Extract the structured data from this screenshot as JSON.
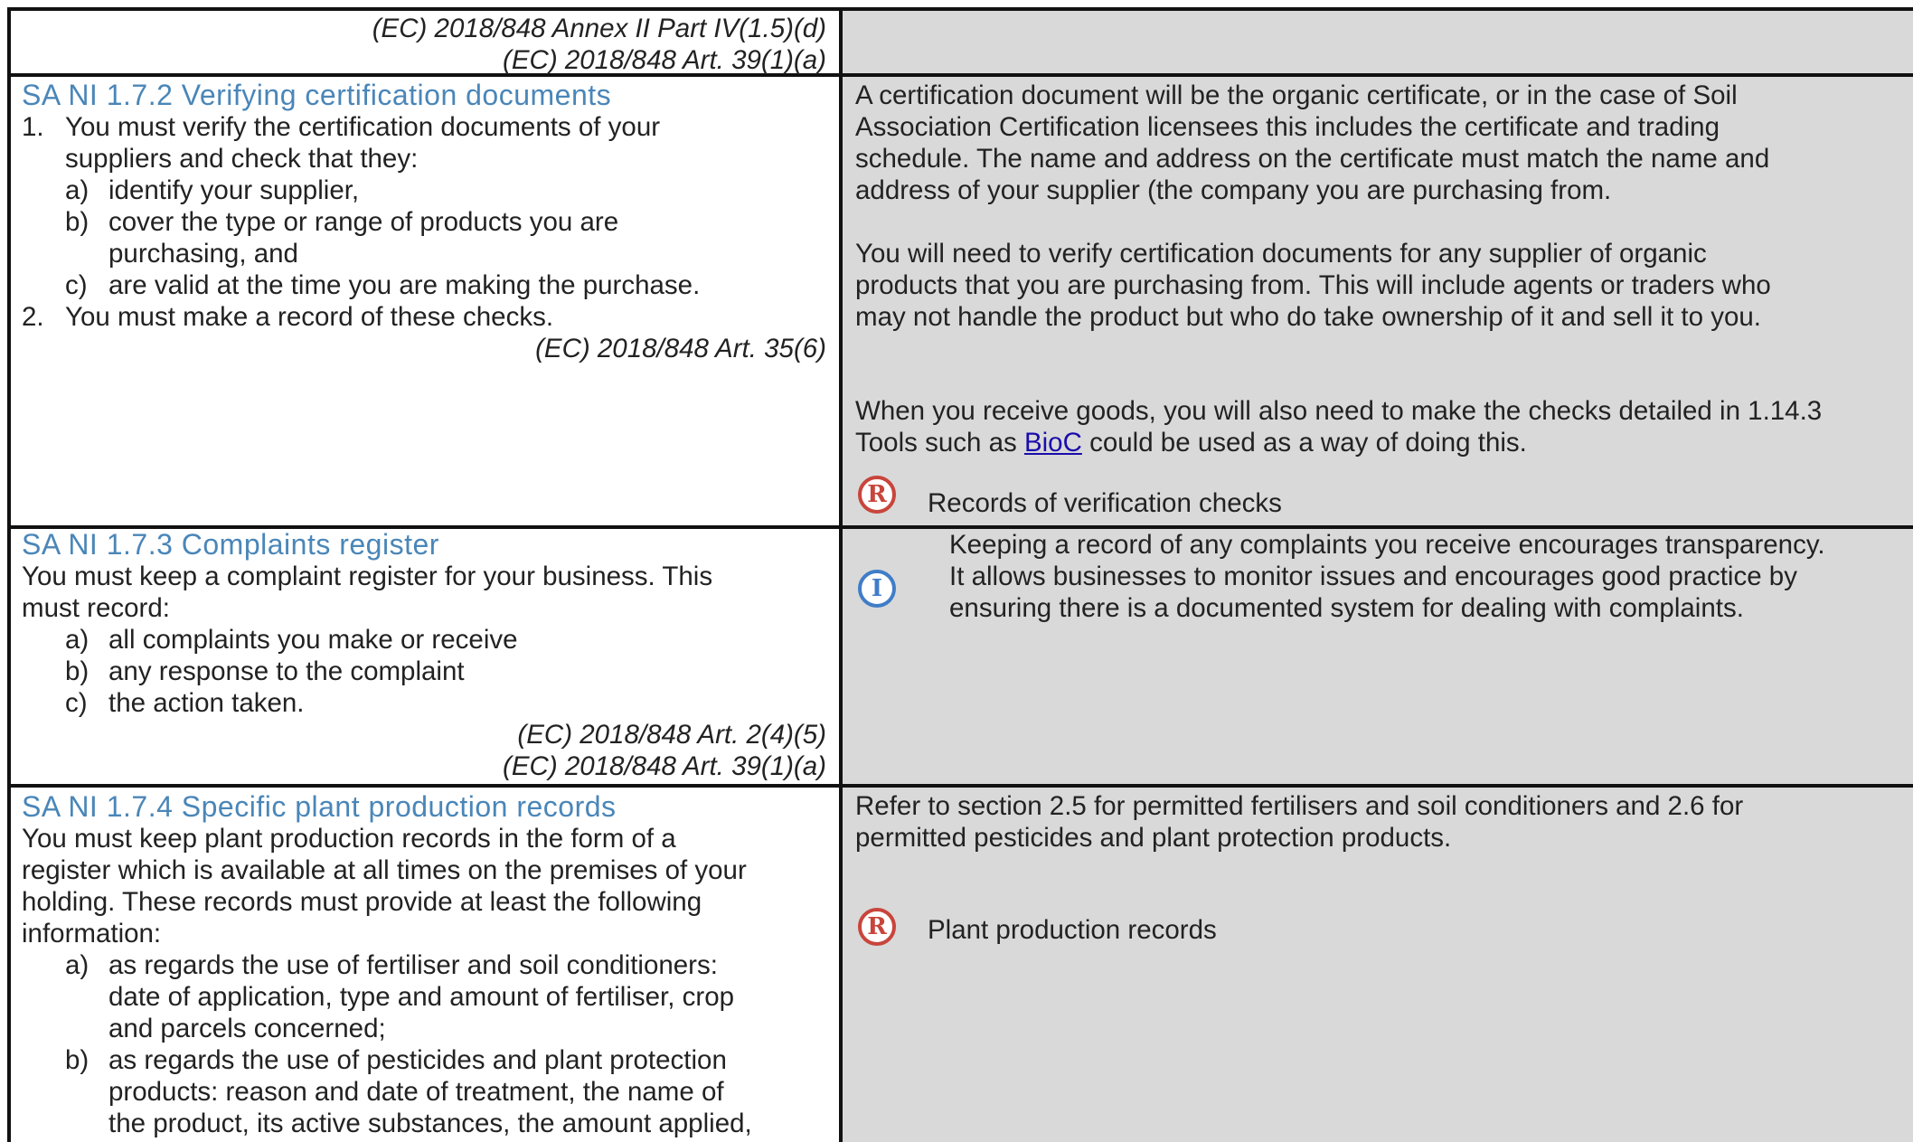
{
  "row0": {
    "refs": [
      "(EC) 2018/848 Annex II Part IV(1.5)(d)",
      "(EC) 2018/848 Art. 39(1)(a)"
    ]
  },
  "s172": {
    "heading": "SA NI 1.7.2 Verifying certification documents",
    "item1_num": "1.",
    "item1_lines": [
      "You must verify the certification documents of your",
      "suppliers and check that they:"
    ],
    "sub_a": {
      "marker": "a)",
      "lines": [
        "identify your supplier,"
      ]
    },
    "sub_b": {
      "marker": "b)",
      "lines": [
        "cover the type or range of products you are",
        "purchasing, and"
      ]
    },
    "sub_c": {
      "marker": "c)",
      "lines": [
        "are valid at the time you are making the purchase."
      ]
    },
    "item2_num": "2.",
    "item2_lines": [
      "You must make a record of these checks."
    ],
    "ref": "(EC) 2018/848 Art. 35(6)",
    "guidance": [
      "A certification document will be the organic certificate, or in the case of Soil",
      "Association Certification licensees this includes the certificate and trading",
      "schedule. The name and address on the certificate must match the name and",
      "address of your supplier (the company you are purchasing from.",
      "You will need to verify certification documents for any supplier of organic",
      "products that you are purchasing from. This will include agents or traders who",
      "may not handle the product but who do take ownership of it and sell it to you.",
      "When you receive goods, you will also need to make the checks detailed in 1.14.3"
    ],
    "tools_before": "Tools such as ",
    "tools_link": "BioC",
    "tools_after": " could be used as a way of doing this.",
    "record_badge": "R",
    "record_label": "Records of verification checks"
  },
  "s173": {
    "heading": "SA NI 1.7.3 Complaints register",
    "intro_lines": [
      "You must keep a complaint register for your business. This",
      "must record:"
    ],
    "sub_a": {
      "marker": "a)",
      "text": "all complaints you make or receive"
    },
    "sub_b": {
      "marker": "b)",
      "text": "any response to the complaint"
    },
    "sub_c": {
      "marker": "c)",
      "text": "the action taken."
    },
    "refs": [
      "(EC) 2018/848 Art. 2(4)(5)",
      "(EC) 2018/848 Art. 39(1)(a)"
    ],
    "info_badge": "I",
    "info_lines": [
      "Keeping a record of any complaints you receive encourages transparency.",
      "It allows businesses to monitor issues and encourages good practice by",
      "ensuring there is a documented system for dealing with complaints."
    ]
  },
  "s174": {
    "heading": "SA NI 1.7.4 Specific plant production records",
    "intro_lines": [
      "You must keep plant production records in the form of a",
      "register which is available at all times on the premises of your",
      "holding. These records must provide at least the following",
      "information:"
    ],
    "sub_a": {
      "marker": "a)",
      "lines": [
        "as regards the use of fertiliser and soil conditioners:",
        "date of application, type and amount of fertiliser, crop",
        "and parcels concerned;"
      ]
    },
    "sub_b": {
      "marker": "b)",
      "lines": [
        "as regards the use of pesticides and plant protection",
        "products: reason and date of treatment, the name of",
        "the product, its active substances, the amount applied,"
      ]
    },
    "guidance": [
      "Refer to section 2.5 for permitted fertilisers and soil conditioners and 2.6 for",
      "permitted pesticides and plant protection products."
    ],
    "record_badge": "R",
    "record_label": "Plant production records"
  }
}
